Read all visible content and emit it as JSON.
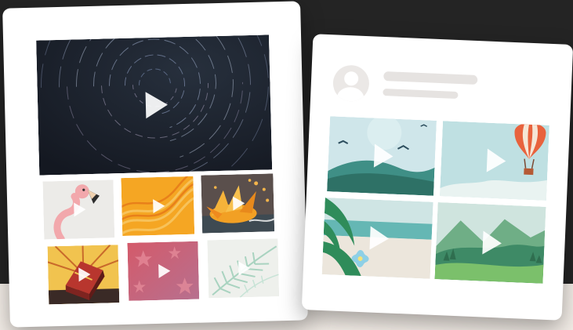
{
  "colors": {
    "background": "#242424",
    "floor": "#f3ede7",
    "card": "#ffffff",
    "placeholder": "#e6e3e1"
  },
  "left_card": {
    "featured_video": {
      "icon": "play-icon",
      "theme": "star-trails-night-sky"
    },
    "grid_videos": [
      {
        "theme": "flamingo",
        "icon": "play-icon"
      },
      {
        "theme": "orange-waves",
        "icon": "play-icon"
      },
      {
        "theme": "autumn-leaves-burst",
        "icon": "play-icon"
      },
      {
        "theme": "treasure-box-rays",
        "icon": "play-icon"
      },
      {
        "theme": "pink-stars",
        "icon": "play-icon"
      },
      {
        "theme": "palm-leaves",
        "icon": "play-icon"
      }
    ]
  },
  "right_card": {
    "profile": {
      "avatar_icon": "user-avatar-icon"
    },
    "grid_videos": [
      {
        "theme": "hills-with-birds",
        "icon": "play-icon"
      },
      {
        "theme": "hot-air-balloon",
        "icon": "play-icon"
      },
      {
        "theme": "beach-palm-flower",
        "icon": "play-icon"
      },
      {
        "theme": "green-mountains",
        "icon": "play-icon"
      }
    ]
  }
}
